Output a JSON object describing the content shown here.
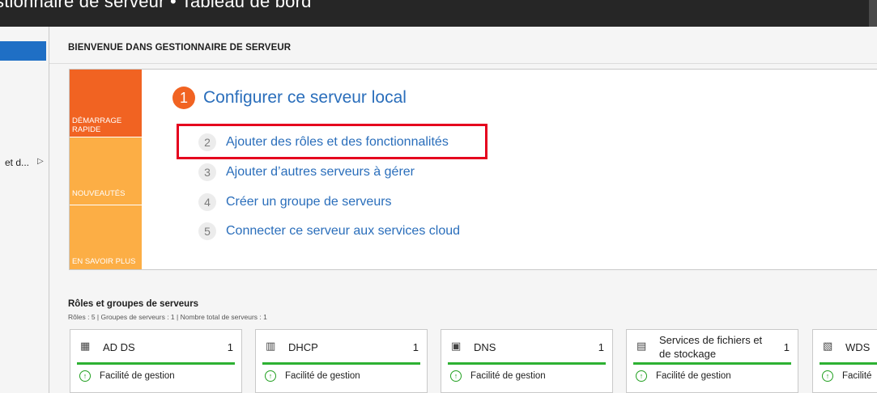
{
  "window": {
    "title": "stionnaire de serveur • Tableau de bord"
  },
  "nav": {
    "item_label": "et d...",
    "item_arrow": "▷"
  },
  "welcome": {
    "title": "BIENVENUE DANS GESTIONNAIRE DE SERVEUR"
  },
  "quick_start": {
    "tiles": [
      "DÉMARRAGE RAPIDE",
      "NOUVEAUTÉS",
      "EN SAVOIR PLUS"
    ],
    "main_step": {
      "number": "1",
      "label": "Configurer ce serveur local"
    },
    "steps": [
      {
        "number": "2",
        "label": "Ajouter des rôles et des fonctionnalités"
      },
      {
        "number": "3",
        "label": "Ajouter d’autres serveurs à gérer"
      },
      {
        "number": "4",
        "label": "Créer un groupe de serveurs"
      },
      {
        "number": "5",
        "label": "Connecter ce serveur aux services cloud"
      }
    ]
  },
  "roles": {
    "title": "Rôles et groupes de serveurs",
    "summary": "Rôles : 5   |   Groupes de serveurs : 1   |   Nombre total de serveurs : 1",
    "cards": [
      {
        "name": "AD DS",
        "count": "1",
        "status": "Facilité de gestion",
        "icon": "ad-ds-icon"
      },
      {
        "name": "DHCP",
        "count": "1",
        "status": "Facilité de gestion",
        "icon": "dhcp-icon"
      },
      {
        "name": "DNS",
        "count": "1",
        "status": "Facilité de gestion",
        "icon": "dns-icon"
      },
      {
        "name": "Services de fichiers et de stockage",
        "count": "1",
        "status": "Facilité de gestion",
        "icon": "file-storage-icon"
      },
      {
        "name": "WDS",
        "count": "",
        "status": "Facilité",
        "icon": "wds-icon"
      }
    ]
  },
  "colors": {
    "accent_orange": "#f16322",
    "tile_light_orange": "#fcae45",
    "link_blue": "#2a6ebb",
    "highlight_red": "#e5001e",
    "status_green": "#2db132",
    "nav_selected": "#1f6fc5"
  }
}
